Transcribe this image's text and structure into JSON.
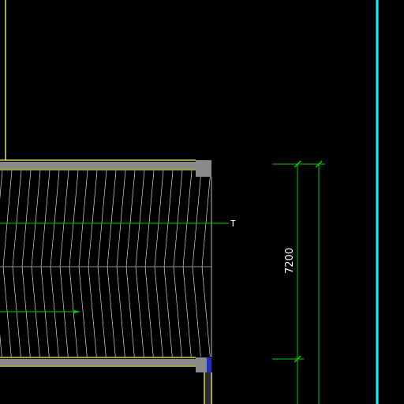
{
  "view": {
    "background": "#000000",
    "layer_colors": {
      "wall": "#ffff66",
      "column": "#8a8a8a",
      "column_marker": "#1f2fbf",
      "hatch": "#d8d8d8",
      "axis": "#00d000",
      "dimension": "#00d000",
      "dimension_text": "#ffffff",
      "border": "#00ffff"
    }
  },
  "annotations": {
    "dimension_value": "7200",
    "axis_tag": "T"
  }
}
